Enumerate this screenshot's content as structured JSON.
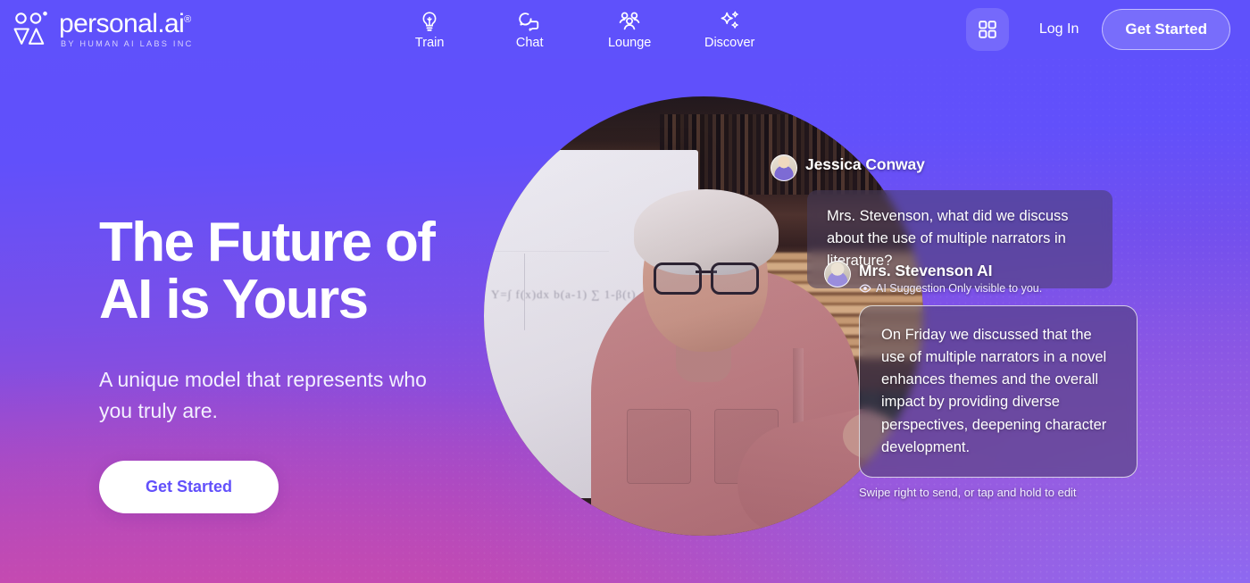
{
  "brand": {
    "name": "personal.ai",
    "trademark": "®",
    "tagline": "BY HUMAN AI LABS INC",
    "logo_icon": "personal-ai-logo-icon",
    "accent_color": "#5f51fb",
    "cta_text_color": "#6250fb"
  },
  "header": {
    "nav": [
      {
        "label": "Train",
        "icon": "lightbulb-icon"
      },
      {
        "label": "Chat",
        "icon": "chat-bubbles-icon"
      },
      {
        "label": "Lounge",
        "icon": "people-group-icon"
      },
      {
        "label": "Discover",
        "icon": "sparkles-icon"
      }
    ],
    "apps_icon": "grid-apps-icon",
    "login_label": "Log In",
    "get_started_label": "Get Started"
  },
  "hero": {
    "title_line1": "The Future of",
    "title_line2": "AI is Yours",
    "subtitle": "A unique model that represents who you truly are.",
    "cta_label": "Get Started",
    "photo_alt": "woman-teacher-whiteboard-photo"
  },
  "chat": {
    "messages": [
      {
        "sender": "Jessica Conway",
        "avatar": "jessica-conway-avatar",
        "text": "Mrs. Stevenson, what did we discuss about the use of multiple narrators in literature?",
        "note": null,
        "note_icon": null
      },
      {
        "sender": "Mrs. Stevenson AI",
        "avatar": "mrs-stevenson-ai-avatar",
        "text": "On Friday we discussed that the use of multiple narrators in a novel enhances themes and the overall impact by providing diverse perspectives, deepening character development.",
        "note": "AI Suggestion Only visible to you.",
        "note_icon": "eye-icon"
      }
    ],
    "hint": "Swipe right to send, or tap and hold to edit"
  }
}
